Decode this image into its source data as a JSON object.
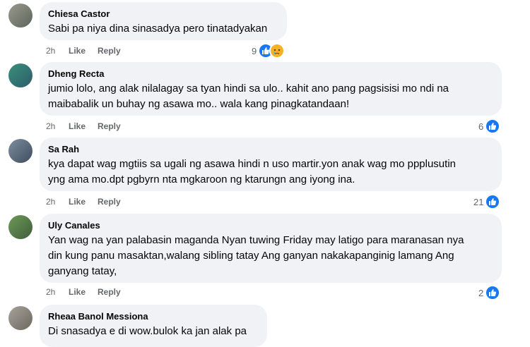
{
  "comments": [
    {
      "name": "Chiesa Castor",
      "lines": [
        "Sabi pa niya dina sinasadya pero tinatadyakan"
      ],
      "time": "2h",
      "like": "Like",
      "reply": "Reply",
      "reaction_count": "9",
      "reactions": [
        "like-icon",
        "sad-icon"
      ]
    },
    {
      "name": "Dheng Recta",
      "lines": [
        "jumio lolo, ang alak nilalagay sa tyan hindi sa ulo.. kahit ano pang pagsisisi mo ndi na",
        "maibabalik un buhay ng asawa mo.. wala kang pinagkatandaan!"
      ],
      "time": "2h",
      "like": "Like",
      "reply": "Reply",
      "reaction_count": "6",
      "reactions": [
        "like-icon"
      ]
    },
    {
      "name": "Sa Rah",
      "lines": [
        "kya dapat wag mgtiis sa ugali ng asawa hindi n uso martir.yon anak wag mo ppplusutin",
        "yng ama mo.dpt pgbyrn nta mgkaroon ng ktarungn ang iyong ina."
      ],
      "time": "2h",
      "like": "Like",
      "reply": "Reply",
      "reaction_count": "21",
      "reactions": [
        "like-icon"
      ]
    },
    {
      "name": "Uly Canales",
      "lines": [
        "Yan wag na yan palabasin maganda Nyan tuwing Friday may latigo para maranasan nya",
        "din kung panu masaktan,walang sibling tatay Ang ganyan nakakapanginig lamang Ang",
        "ganyang tatay,"
      ],
      "time": "2h",
      "like": "Like",
      "reply": "Reply",
      "reaction_count": "2",
      "reactions": [
        "like-icon"
      ]
    },
    {
      "name": "Rheaa Banol Messiona",
      "lines": [
        "Di snasadya e di wow.bulok ka jan alak pa"
      ],
      "time": "",
      "like": "",
      "reply": "",
      "reaction_count": "",
      "reactions": []
    }
  ],
  "colors": {
    "bubble": "#f0f2f5",
    "like_blue": "#1877f2",
    "sad_yellow": "#f7b125",
    "meta_gray": "#65676b"
  }
}
